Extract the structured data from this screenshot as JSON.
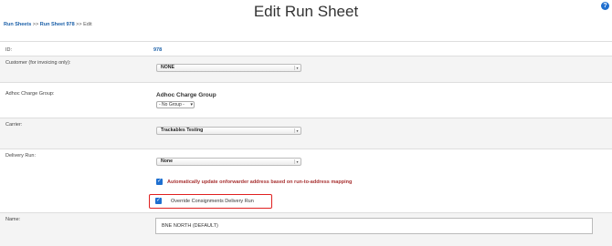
{
  "page": {
    "title": "Edit Run Sheet",
    "help_icon": "?"
  },
  "breadcrumb": {
    "item1": "Run Sheets",
    "sep1": " >> ",
    "item2": "Run Sheet 978",
    "sep2": " >> ",
    "current": "Edit"
  },
  "form": {
    "id": {
      "label": "ID:",
      "value": "978"
    },
    "customer": {
      "label": "Customer (for invoicing only):",
      "value": "NONE"
    },
    "adhoc": {
      "label": "Adhoc Charge Group:",
      "heading": "Adhoc Charge Group",
      "value": "- No Group -"
    },
    "carrier": {
      "label": "Carrier:",
      "value": "Trackables Testing"
    },
    "delivery_run": {
      "label": "Delivery Run:",
      "value": "None"
    },
    "auto_update": {
      "label": "Automatically update onforwarder address based on run-to-address mapping",
      "checked": true
    },
    "override": {
      "label": "Override Consignments Delivery Run",
      "checked": true
    },
    "name": {
      "label": "Name:",
      "value": "BNE NORTH (DEFAULT)"
    }
  },
  "colors": {
    "accent": "#1e6fd0",
    "highlight_border": "#e02020",
    "link": "#1a5fa8"
  }
}
